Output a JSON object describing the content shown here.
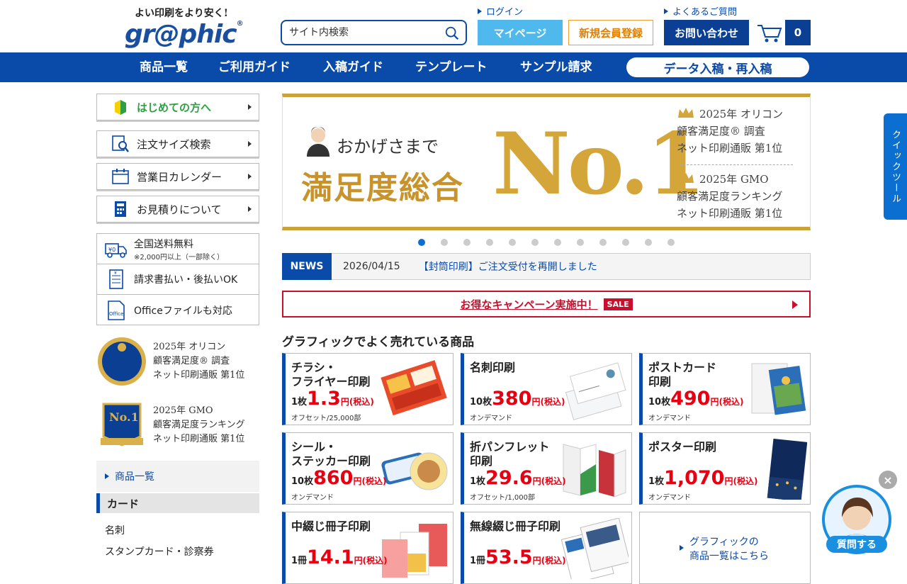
{
  "header": {
    "tagline": "よい印刷をより安く!",
    "logo": "gr@phic",
    "search_placeholder": "サイト内検索",
    "login": "ログイン",
    "faq": "よくあるご質問",
    "mypage": "マイページ",
    "register": "新規会員登録",
    "contact": "お問い合わせ",
    "cart_count": "0"
  },
  "nav": {
    "items": [
      "商品一覧",
      "ご利用ガイド",
      "入稿ガイド",
      "テンプレート",
      "サンプル請求"
    ],
    "data_upload": "データ入稿・再入稿"
  },
  "sidebar": {
    "beginner": "はじめての方へ",
    "size_search": "注文サイズ検索",
    "calendar": "営業日カレンダー",
    "estimate": "お見積りについて",
    "features": [
      {
        "title": "全国送料無料",
        "sub": "※2,000円以上（一部除く）"
      },
      {
        "title": "請求書払い・後払いOK",
        "sub": ""
      },
      {
        "title": "Officeファイルも対応",
        "sub": ""
      }
    ],
    "awards": [
      {
        "line1": "2025年 オリコン",
        "line2": "顧客満足度® 調査",
        "line3": "ネット印刷通販 第1位"
      },
      {
        "line1": "2025年 GMO",
        "line2": "顧客満足度ランキング",
        "line3": "ネット印刷通販 第1位"
      }
    ],
    "product_list_link": "商品一覧",
    "category_head": "カード",
    "category_items": [
      "名刺",
      "スタンプカード・診察券"
    ]
  },
  "banner": {
    "thanks": "おかげさまで",
    "satisfaction": "満足度総合",
    "no1": "No.1",
    "rank1": [
      "2025年 オリコン",
      "顧客満足度® 調査",
      "ネット印刷通販 第1位"
    ],
    "rank2": [
      "2025年 GMO",
      "顧客満足度ランキング",
      "ネット印刷通販 第1位"
    ],
    "slide_count": 12,
    "active_slide": 1
  },
  "news": {
    "tag": "NEWS",
    "date": "2026/04/15",
    "headline": "【封筒印刷】ご注文受付を再開しました"
  },
  "campaign": {
    "text": "お得なキャンペーン実施中！",
    "badge": "SALE"
  },
  "products_title": "グラフィックでよく売れている商品",
  "products": [
    {
      "name1": "チラシ・",
      "name2": "フライヤー印刷",
      "qty": "1枚",
      "amount": "1.3",
      "unit": "円(税込)",
      "note": "オフセット/25,000部"
    },
    {
      "name1": "名刺印刷",
      "name2": "",
      "qty": "10枚",
      "amount": "380",
      "unit": "円(税込)",
      "note": "オンデマンド"
    },
    {
      "name1": "ポストカード",
      "name2": "印刷",
      "qty": "10枚",
      "amount": "490",
      "unit": "円(税込)",
      "note": "オンデマンド"
    },
    {
      "name1": "シール・",
      "name2": "ステッカー印刷",
      "qty": "10枚",
      "amount": "860",
      "unit": "円(税込)",
      "note": "オンデマンド"
    },
    {
      "name1": "折パンフレット",
      "name2": "印刷",
      "qty": "1枚",
      "amount": "29.6",
      "unit": "円(税込)",
      "note": "オフセット/1,000部"
    },
    {
      "name1": "ポスター印刷",
      "name2": "",
      "qty": "1枚",
      "amount": "1,070",
      "unit": "円(税込)",
      "note": "オンデマンド"
    },
    {
      "name1": "中綴じ冊子印刷",
      "name2": "",
      "qty": "1冊",
      "amount": "14.1",
      "unit": "円(税込)",
      "note": ""
    },
    {
      "name1": "無線綴じ冊子印刷",
      "name2": "",
      "qty": "1冊",
      "amount": "53.5",
      "unit": "円(税込)",
      "note": ""
    }
  ],
  "all_products": {
    "line1": "グラフィックの",
    "line2": "商品一覧はこちら"
  },
  "quick_tool": "クイックツール",
  "chat": {
    "label": "質問する",
    "close": "×"
  },
  "colors": {
    "brand": "#0a4aa8",
    "accent": "#4fb9ee",
    "price": "#e60012",
    "gold": "#c9a23a"
  }
}
